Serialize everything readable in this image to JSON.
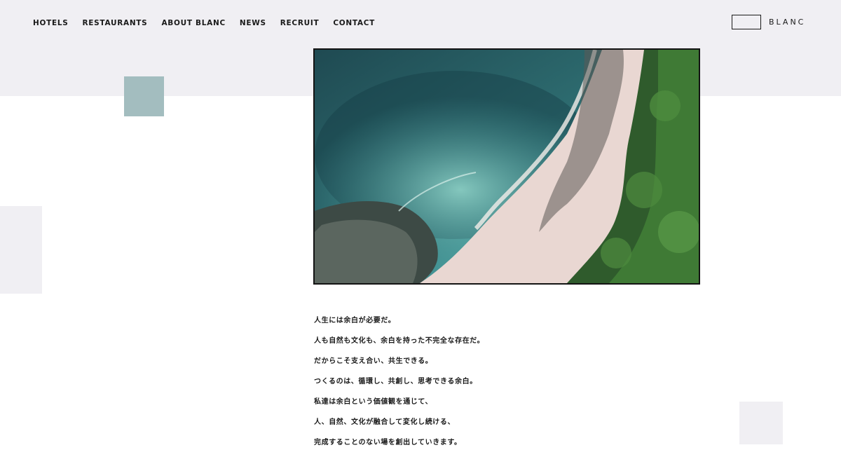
{
  "nav": {
    "items": [
      {
        "label": "HOTELS"
      },
      {
        "label": "RESTAURANTS"
      },
      {
        "label": "ABOUT BLANC"
      },
      {
        "label": "NEWS"
      },
      {
        "label": "RECRUIT"
      },
      {
        "label": "CONTACT"
      }
    ]
  },
  "logo": {
    "text": "BLANC"
  },
  "colors": {
    "band": "#f0eff3",
    "accent_teal": "#a3bdbf",
    "text": "#1a1a1a"
  },
  "copy": {
    "lines": [
      "人生には余白が必要だ。",
      "人も自然も文化も、余白を持った不完全な存在だ。",
      "だからこそ支え合い、共生できる。",
      "つくるのは、循環し、共創し、思考できる余白。",
      "私達は余白という価値観を通じて、",
      "人、自然、文化が融合して変化し続ける、",
      "完成することのない場を創出していきます。"
    ]
  }
}
